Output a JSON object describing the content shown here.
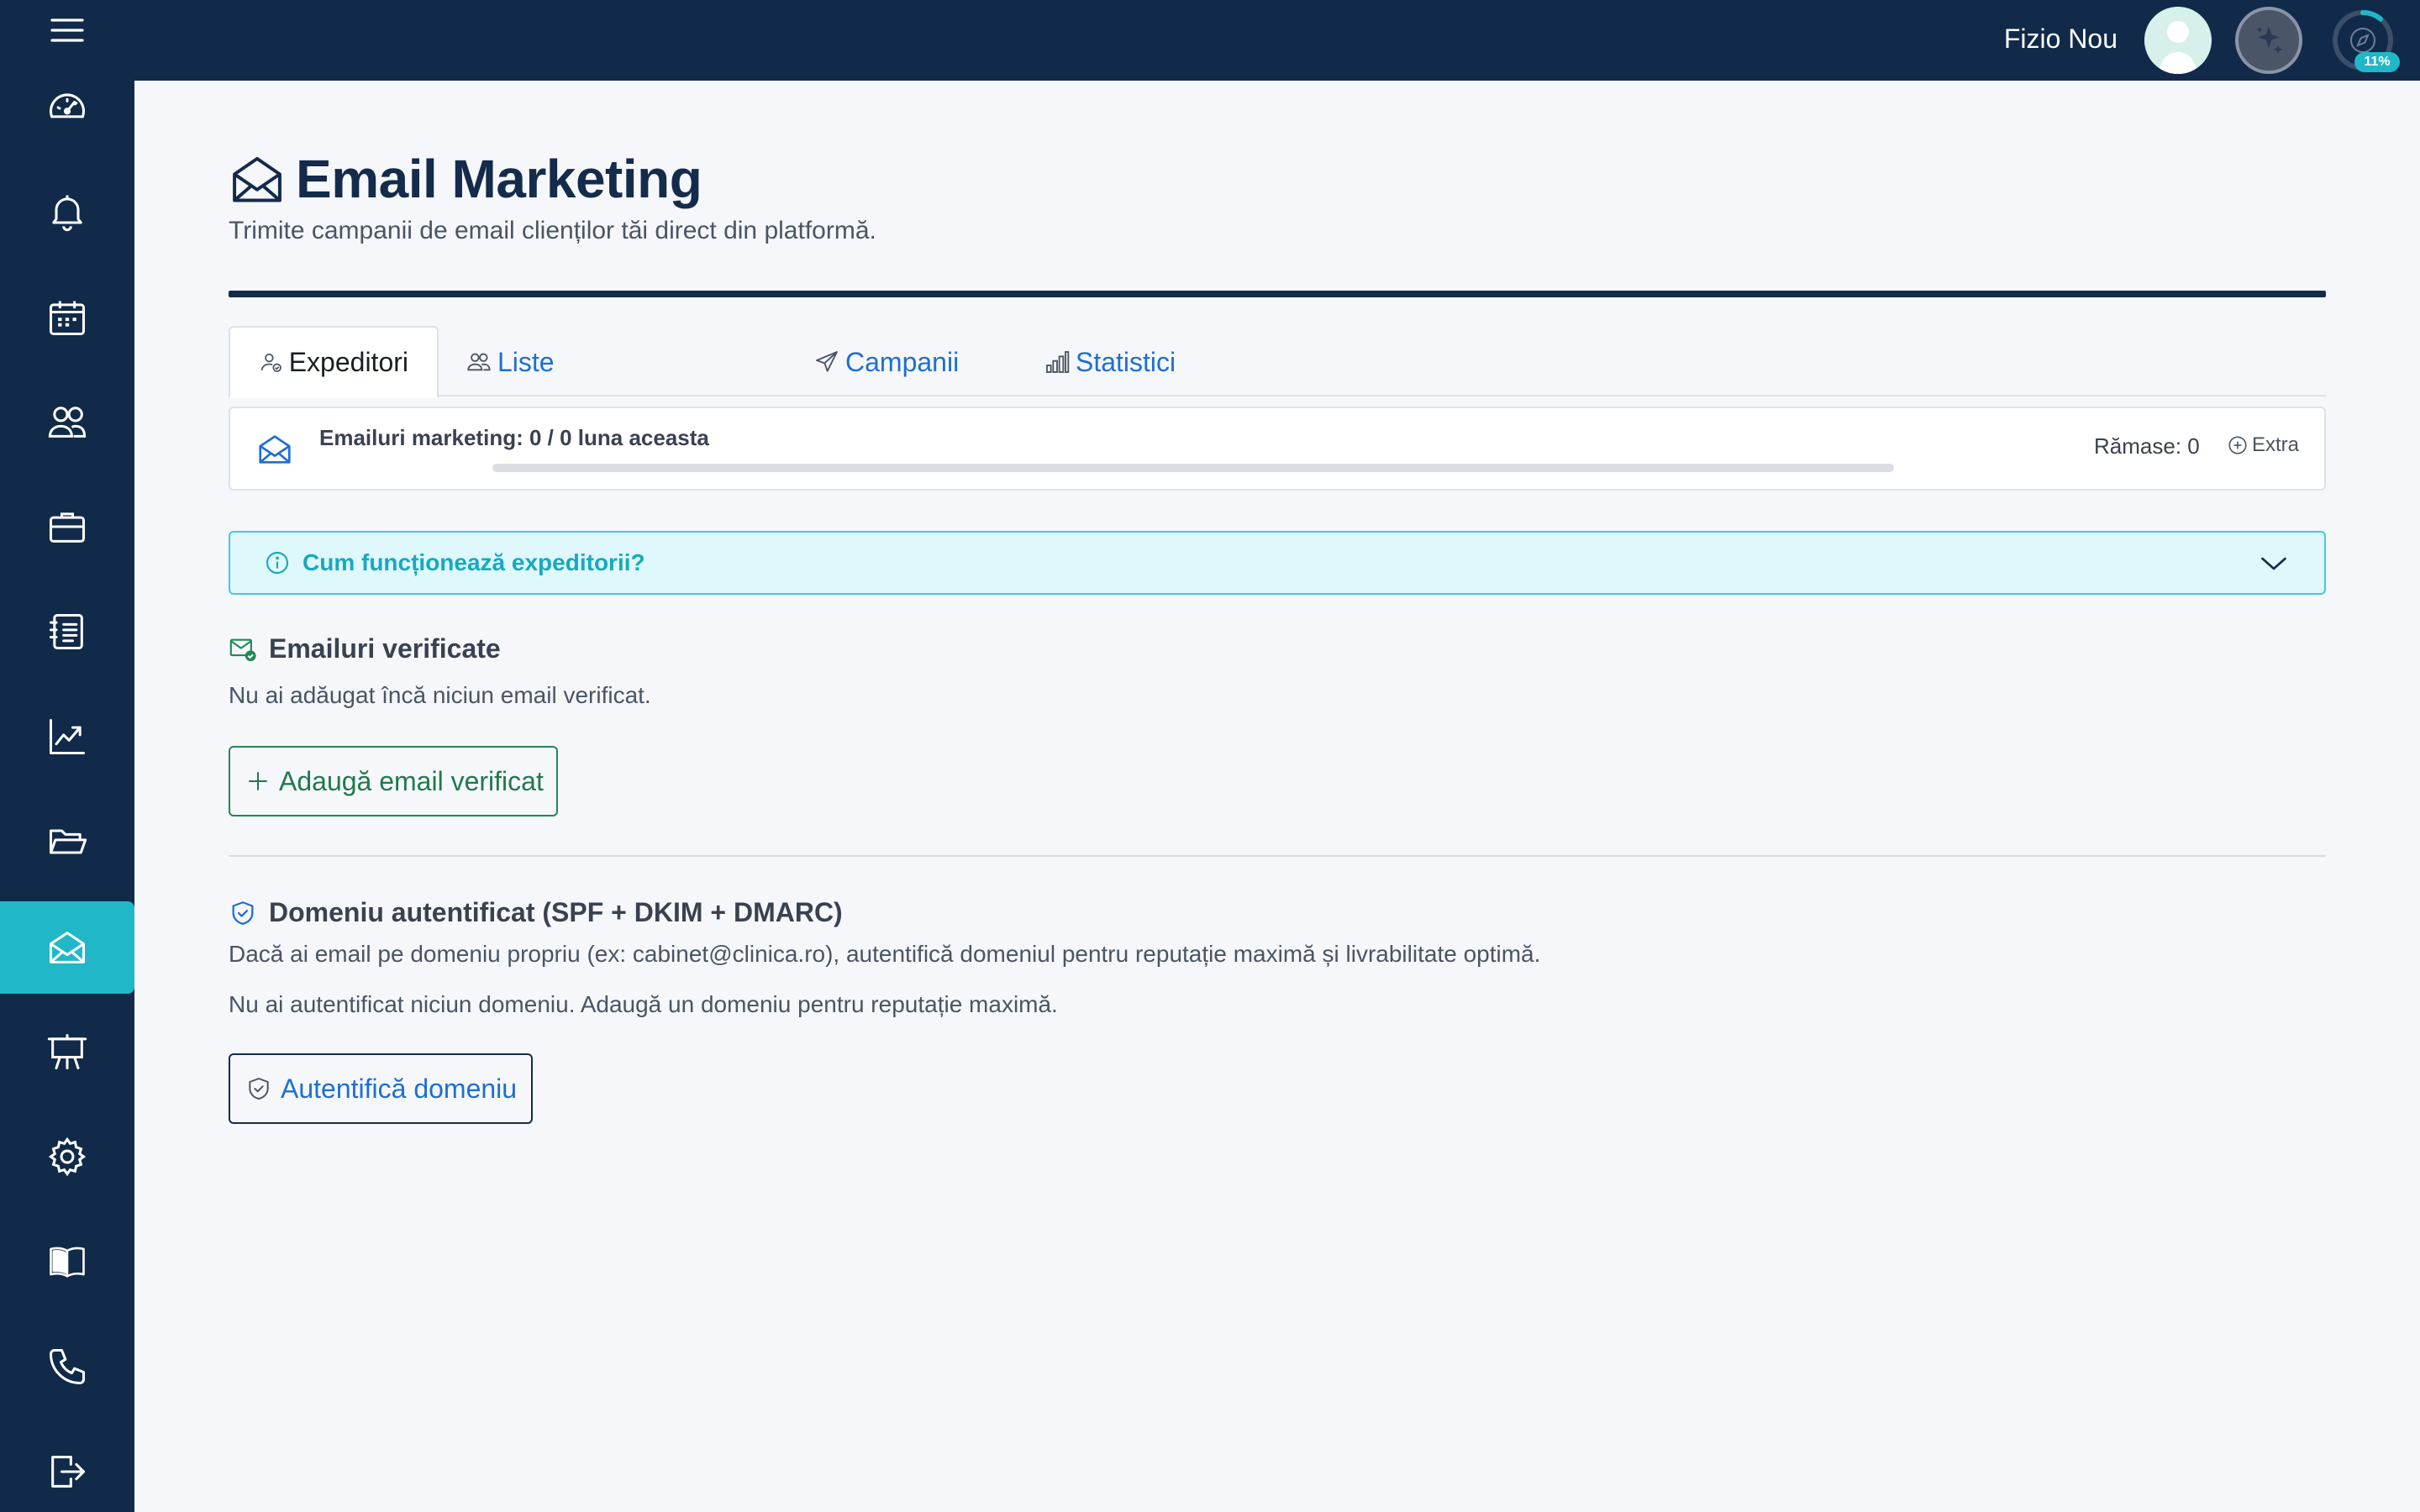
{
  "topbar": {
    "user_name": "Fizio Nou",
    "progress_badge": "11%",
    "progress_value": 0.11
  },
  "sidebar": {
    "items": [
      {
        "name": "dashboard",
        "icon": "speedometer-icon"
      },
      {
        "name": "notifications",
        "icon": "bell-icon"
      },
      {
        "name": "calendar",
        "icon": "calendar-icon"
      },
      {
        "name": "clients",
        "icon": "users-icon"
      },
      {
        "name": "services",
        "icon": "briefcase-icon"
      },
      {
        "name": "records",
        "icon": "journal-icon"
      },
      {
        "name": "reports",
        "icon": "chart-line-icon"
      },
      {
        "name": "files",
        "icon": "folder-icon"
      },
      {
        "name": "email-marketing",
        "icon": "envelope-open-icon",
        "active": true
      },
      {
        "name": "presentations",
        "icon": "easel-icon"
      },
      {
        "name": "settings",
        "icon": "gear-icon"
      },
      {
        "name": "guide",
        "icon": "book-icon"
      },
      {
        "name": "contact",
        "icon": "phone-icon"
      },
      {
        "name": "logout",
        "icon": "logout-icon"
      }
    ]
  },
  "page": {
    "title": "Email Marketing",
    "subtitle": "Trimite campanii de email clienților tăi direct din platformă."
  },
  "tabs": [
    {
      "label": "Expeditori",
      "icon": "person-check-icon",
      "active": true
    },
    {
      "label": "Liste",
      "icon": "people-icon"
    },
    {
      "label": "Campanii",
      "icon": "send-icon"
    },
    {
      "label": "Statistici",
      "icon": "bar-chart-icon"
    }
  ],
  "quota": {
    "label": "Emailuri marketing: 0 / 0 luna aceasta",
    "used_fraction": 0,
    "remaining": "Rămase: 0",
    "extra_label": "Extra"
  },
  "info_banner": {
    "text": "Cum funcționează expeditorii?"
  },
  "verified": {
    "heading": "Emailuri verificate",
    "empty_text": "Nu ai adăugat încă niciun email verificat.",
    "add_button": "Adaugă email verificat"
  },
  "domain": {
    "heading": "Domeniu autentificat (SPF + DKIM + DMARC)",
    "description": "Dacă ai email pe domeniu propriu (ex: cabinet@clinica.ro), autentifică domeniul pentru reputație maximă și livrabilitate optimă.",
    "empty_text": "Nu ai autentificat niciun domeniu. Adaugă un domeniu pentru reputație maximă.",
    "auth_button": "Autentifică domeniu"
  },
  "colors": {
    "navy": "#112a4a",
    "accent": "#20b8c8",
    "link_blue": "#1d6fd1",
    "success_green": "#1f8a55"
  }
}
